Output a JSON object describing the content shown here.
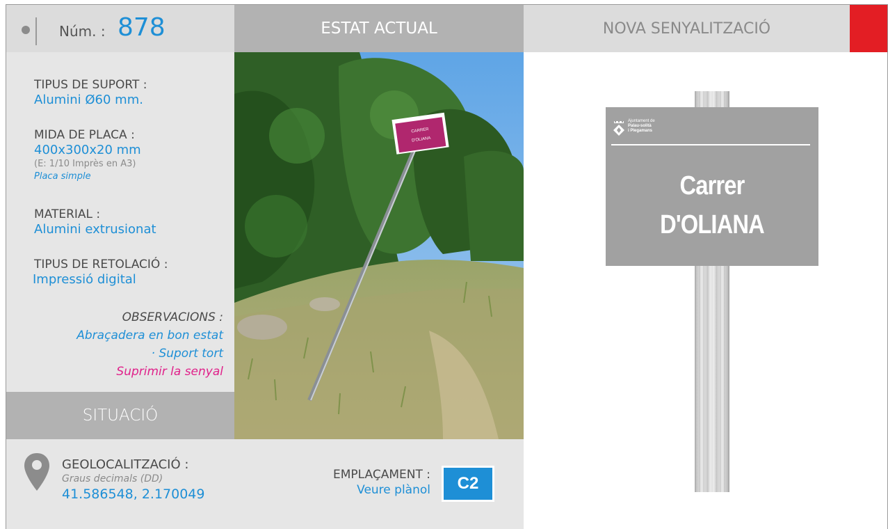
{
  "header": {
    "num_label": "Núm. :",
    "num_value": "878",
    "estat_actual": "ESTAT ACTUAL",
    "nova_senyalitzacio": "NOVA SENYALITZACIÓ"
  },
  "fields": {
    "suport_label": "TIPUS DE SUPORT :",
    "suport_value": "Alumini Ø60 mm.",
    "mida_label": "MIDA DE PLACA :",
    "mida_value": "400x300x20 mm",
    "mida_scale": "(E: 1/10 Imprès en A3)",
    "mida_type": "Placa simple",
    "material_label": "MATERIAL :",
    "material_value": "Alumini extrusionat",
    "retolacio_label": "TIPUS DE RETOLACIÓ :",
    "retolacio_value": "Impressió digital"
  },
  "observacions": {
    "label": "OBSERVACIONS :",
    "line1": "Abraçadera en bon estat",
    "line2": "· Suport tort",
    "action": "Suprimir la senyal"
  },
  "situacio": "SITUACIÓ",
  "geo": {
    "label": "GEOLOCALITZACIÓ :",
    "format": "Graus decimals (DD)",
    "coords": "41.586548, 2.170049"
  },
  "emplacament": {
    "label": "EMPLAÇAMENT :",
    "link": "Veure plànol",
    "code": "C2"
  },
  "photo_sign": {
    "line1": "CARRER",
    "line2": "D'OLIANA"
  },
  "new_sign": {
    "org_line1": "Ajuntament de",
    "org_line2": "Palau-solità",
    "org_line3": "i Plegamans",
    "line1": "Carrer",
    "line2": "D'OLIANA"
  },
  "colors": {
    "accent": "#1e8fd6",
    "alert": "#e0218a",
    "red_tab": "#e31e24",
    "plate": "#a1a1a1"
  }
}
